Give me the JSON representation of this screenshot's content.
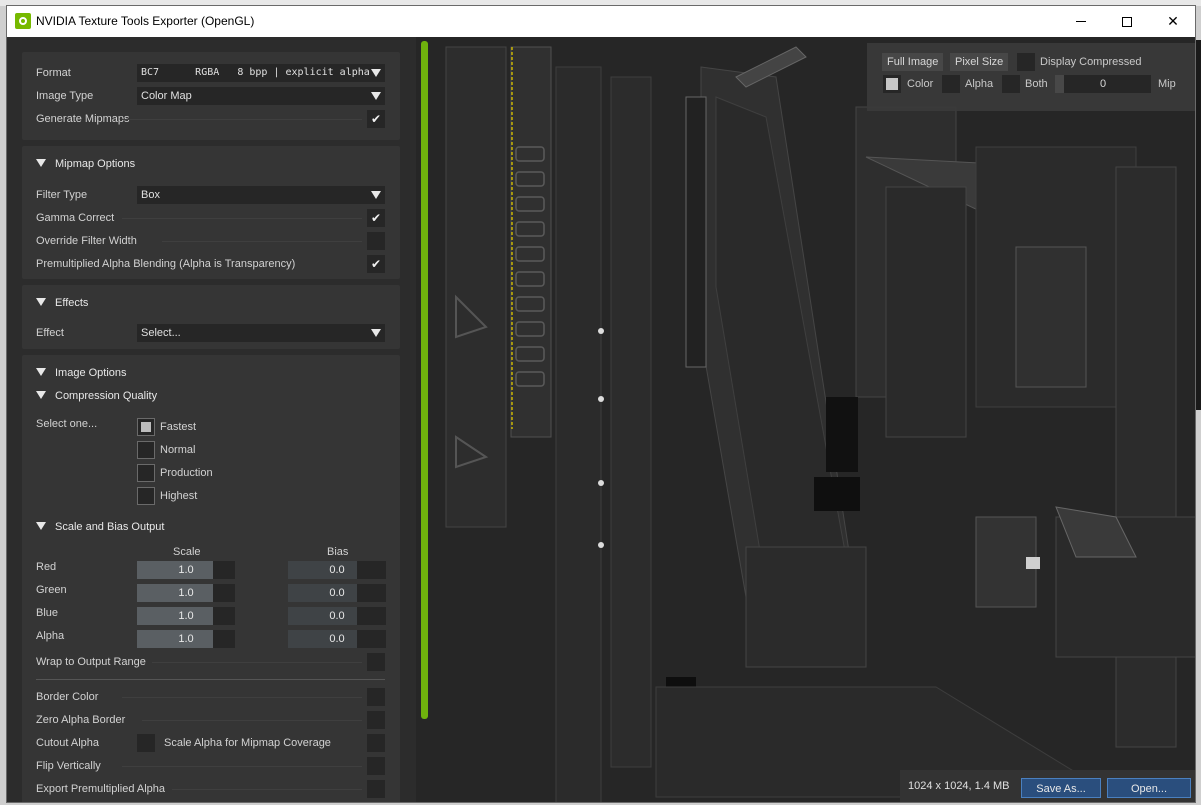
{
  "window": {
    "title": "NVIDIA Texture Tools Exporter (OpenGL)"
  },
  "colors": {
    "accent_green": "#76b900",
    "button_blue": "#2a4e7d",
    "panel": "#353535",
    "background": "#2a2a2a"
  },
  "format": {
    "label": "Format",
    "value": "BC7      RGBA   8 bpp | explicit alpha",
    "image_type_label": "Image Type",
    "image_type_value": "Color Map",
    "generate_mipmaps_label": "Generate Mipmaps",
    "generate_mipmaps_checked": true
  },
  "mipmap_options": {
    "header": "Mipmap Options",
    "filter_type_label": "Filter Type",
    "filter_type_value": "Box",
    "gamma_correct_label": "Gamma Correct",
    "override_filter_width_label": "Override Filter Width",
    "premultiplied_label": "Premultiplied Alpha Blending (Alpha is Transparency)"
  },
  "effects": {
    "header": "Effects",
    "effect_label": "Effect",
    "effect_value": "Select..."
  },
  "image_options": {
    "header": "Image Options",
    "compression_header": "Compression Quality",
    "select_label": "Select one...",
    "qualities": [
      "Fastest",
      "Normal",
      "Production",
      "Highest"
    ],
    "selected_quality": "Fastest",
    "scale_bias_header": "Scale and Bias Output",
    "scale_col": "Scale",
    "bias_col": "Bias",
    "channels": [
      {
        "name": "Red",
        "scale": "1.0",
        "bias": "0.0"
      },
      {
        "name": "Green",
        "scale": "1.0",
        "bias": "0.0"
      },
      {
        "name": "Blue",
        "scale": "1.0",
        "bias": "0.0"
      },
      {
        "name": "Alpha",
        "scale": "1.0",
        "bias": "0.0"
      }
    ],
    "wrap_label": "Wrap to Output Range",
    "border_color_label": "Border Color",
    "zero_alpha_border_label": "Zero Alpha Border",
    "cutout_alpha_label": "Cutout Alpha",
    "scale_alpha_mip_label": "Scale Alpha for Mipmap Coverage",
    "flip_vertically_label": "Flip Vertically",
    "export_premultiplied_label": "Export Premultiplied Alpha"
  },
  "viewer": {
    "full_image": "Full Image",
    "pixel_size": "Pixel Size",
    "display_compressed": "Display Compressed",
    "color": "Color",
    "alpha": "Alpha",
    "both": "Both",
    "mip_value": "0",
    "mip_label": "Mip",
    "status": "1024 x 1024, 1.4 MB",
    "save_as": "Save As...",
    "open": "Open..."
  }
}
